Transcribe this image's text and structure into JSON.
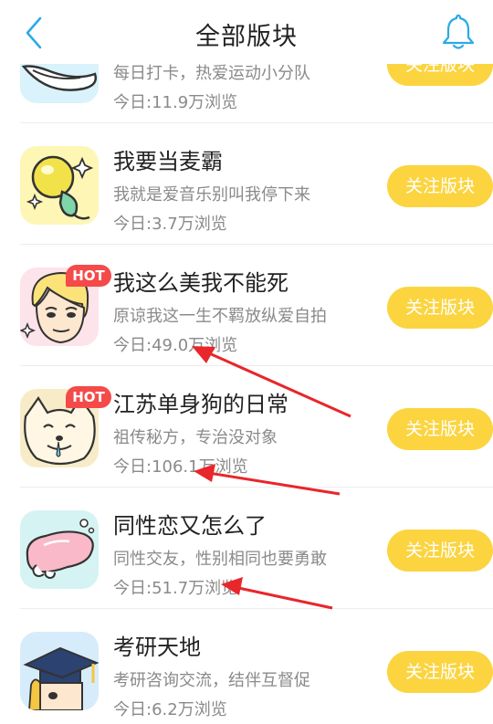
{
  "header": {
    "title": "全部版块"
  },
  "boards": [
    {
      "title": "",
      "desc": "每日打卡，热爱运动小分队",
      "views": "今日:11.9万浏览",
      "follow_label": "关注版块"
    },
    {
      "title": "我要当麦霸",
      "desc": "我就是爱音乐别叫我停下来",
      "views": "今日:3.7万浏览",
      "follow_label": "关注版块"
    },
    {
      "title": "我这么美我不能死",
      "desc": "原谅我这一生不羁放纵爱自拍",
      "views": "今日:49.0万浏览",
      "follow_label": "关注版块",
      "badge": "HOT"
    },
    {
      "title": "江苏单身狗的日常",
      "desc": "祖传秘方，专治没对象",
      "views": "今日:106.1万浏览",
      "follow_label": "关注版块",
      "badge": "HOT"
    },
    {
      "title": "同性恋又怎么了",
      "desc": "同性交友，性别相同也要勇敢",
      "views": "今日:51.7万浏览",
      "follow_label": "关注版块"
    },
    {
      "title": "考研天地",
      "desc": "考研咨询交流，结伴互督促",
      "views": "今日:6.2万浏览",
      "follow_label": "关注版块"
    }
  ],
  "colors": {
    "accent": "#fbd440",
    "back_icon": "#2aa9e8",
    "hot_badge": "#f44a4a",
    "annotation_arrow": "#e8262b"
  }
}
